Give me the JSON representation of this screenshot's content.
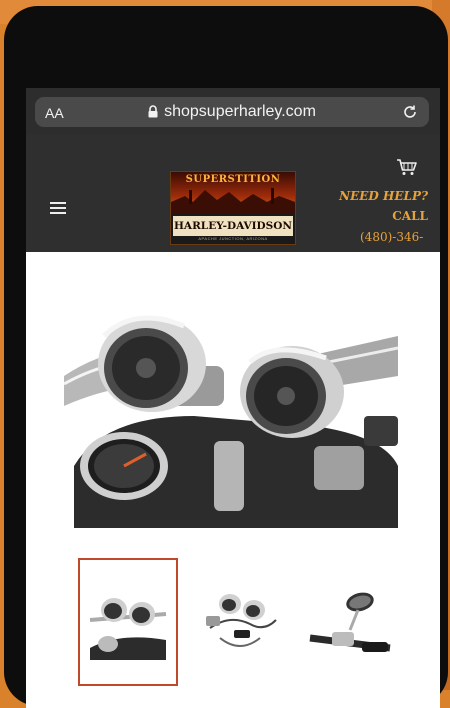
{
  "browser": {
    "text_size_label": "AA",
    "url": "shopsuperharley.com"
  },
  "header": {
    "logo_top_text": "SUPERSTITION",
    "logo_brand_text": "HARLEY-DAVIDSON",
    "logo_tagline": "APACHE JUNCTION, ARIZONA",
    "help_line1": "NEED HELP?",
    "help_line2": "CALL",
    "phone": "(480)-346-"
  },
  "gallery": {
    "main_image": "chrome-handlebar-speakers-photo",
    "thumbnails": [
      {
        "name": "speakers-on-bike-thumbnail",
        "selected": true
      },
      {
        "name": "speaker-kit-parts-thumbnail",
        "selected": false
      },
      {
        "name": "mirror-handlebar-thumbnail",
        "selected": false
      }
    ]
  },
  "colors": {
    "header_bg": "#2f2f2f",
    "help_text": "#e8a23a",
    "thumbnail_selected_border": "#c0492a",
    "background_orange": "#d9822b"
  }
}
